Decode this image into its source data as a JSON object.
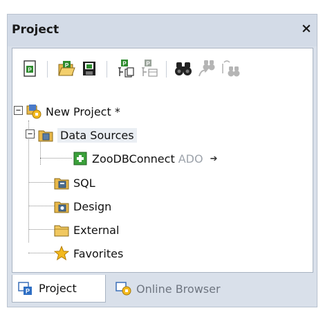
{
  "panel": {
    "title": "Project",
    "close_label": "×"
  },
  "toolbar": {
    "buttons": [
      {
        "name": "new-project-icon"
      },
      {
        "name": "open-project-icon"
      },
      {
        "name": "save-project-icon"
      },
      {
        "name": "add-files-icon"
      },
      {
        "name": "add-folder-icon"
      },
      {
        "name": "find-icon"
      },
      {
        "name": "find-next-icon"
      },
      {
        "name": "replace-icon"
      }
    ]
  },
  "tree": {
    "root": {
      "label": "New Project *",
      "expander": "−"
    },
    "data_sources": {
      "label": "Data Sources",
      "expander": "−"
    },
    "connection": {
      "label": "ZooDBConnect",
      "kind": "ADO",
      "arrow": "➔"
    },
    "sql": {
      "label": "SQL"
    },
    "design": {
      "label": "Design"
    },
    "external": {
      "label": "External"
    },
    "favorites": {
      "label": "Favorites"
    }
  },
  "tabs": [
    {
      "label": "Project",
      "active": true
    },
    {
      "label": "Online Browser",
      "active": false
    }
  ],
  "colors": {
    "panel_bg": "#d9e0ea",
    "folder": "#e8b84a",
    "green": "#2e8b2e",
    "star": "#f3b91d"
  }
}
